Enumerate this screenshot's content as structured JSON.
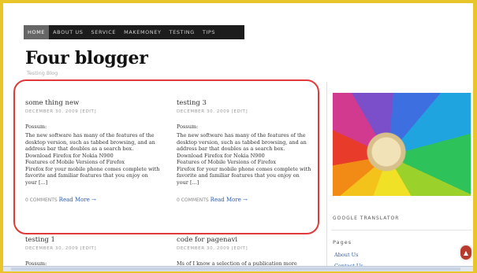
{
  "nav": {
    "items": [
      "Home",
      "About Us",
      "Service",
      "Makemoney",
      "Testing",
      "Tips"
    ]
  },
  "site": {
    "title": "Four blogger",
    "tagline": "Testing Blog"
  },
  "posts": [
    {
      "title": "some thing new",
      "meta": "December 30, 2009 [edit]",
      "label": "Possum:",
      "body": [
        "The new software has many of the features of the",
        "desktop version, such as tabbed browsing, and an",
        "address bar that doubles as a search box.",
        "Download Firefox for Nokia N900",
        "Features of Mobile Versions of Firefox",
        "Firefox for your mobile phone comes complete with",
        "favorite and familiar features that you enjoy on",
        "your [...]"
      ],
      "comments": "0 COMMENTS",
      "more": "Read More →"
    },
    {
      "title": "testing 3",
      "meta": "December 30, 2009 [edit]",
      "label": "Possum:",
      "body": [
        "The new software has many of the features of the",
        "desktop version, such as tabbed browsing, and an",
        "address bar that doubles as a search box.",
        "Download Firefox for Nokia N900",
        "Features of Mobile Versions of Firefox",
        "Firefox for your mobile phone comes complete with",
        "favorite and familiar features that you enjoy on",
        "your [...]"
      ],
      "comments": "0 COMMENTS",
      "more": "Read More →"
    },
    {
      "title": "testing 1",
      "meta": "December 30, 2009 [edit]",
      "label": "Possum:"
    },
    {
      "title": "code for pagenavi",
      "meta": "December 30, 2009 [edit]",
      "label": "Ms of I know a selection of a publication more"
    }
  ],
  "sidebar": {
    "widget_title": "Google Translator",
    "pages_title": "Pages",
    "links": [
      "About Us",
      "Contact Us"
    ]
  },
  "scroll_top": "▲"
}
